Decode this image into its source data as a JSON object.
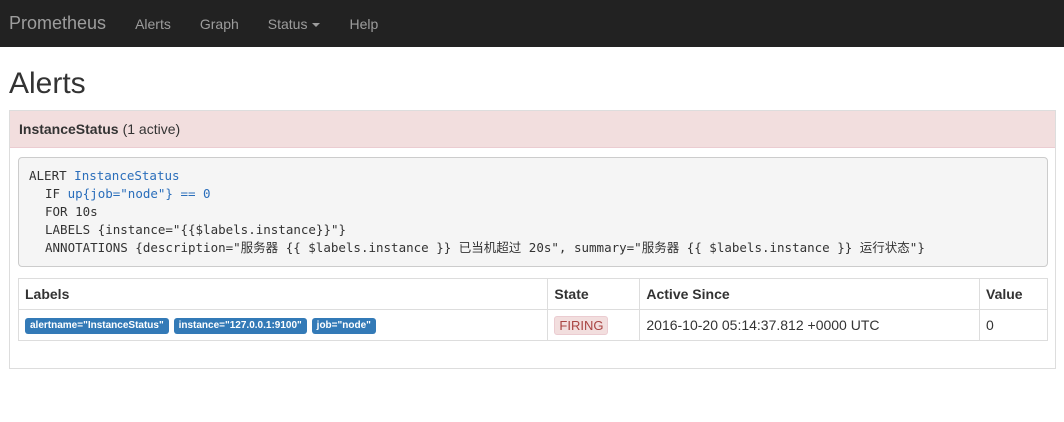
{
  "navbar": {
    "brand": "Prometheus",
    "items": [
      {
        "label": "Alerts"
      },
      {
        "label": "Graph"
      },
      {
        "label": "Status"
      },
      {
        "label": "Help"
      }
    ]
  },
  "page": {
    "title": "Alerts"
  },
  "alert_group": {
    "name": "InstanceStatus",
    "active_count": "(1 active)",
    "rule": {
      "alert_keyword": "ALERT",
      "alert_name": "InstanceStatus",
      "if_keyword": "IF",
      "expr": "up{job=\"node\"} == 0",
      "for_line": "FOR 10s",
      "labels_line": "LABELS {instance=\"{{$labels.instance}}\"}",
      "annotations_line": "ANNOTATIONS {description=\"服务器 {{ $labels.instance }} 已当机超过 20s\", summary=\"服务器 {{ $labels.instance }} 运行状态\"}"
    },
    "table": {
      "headers": {
        "labels": "Labels",
        "state": "State",
        "active_since": "Active Since",
        "value": "Value"
      },
      "rows": [
        {
          "labels": [
            "alertname=\"InstanceStatus\"",
            "instance=\"127.0.0.1:9100\"",
            "job=\"node\""
          ],
          "state": "FIRING",
          "active_since": "2016-10-20 05:14:37.812 +0000 UTC",
          "value": "0"
        }
      ]
    }
  },
  "colors": {
    "navbar_bg": "#222222",
    "nav_text": "#9d9d9d",
    "panel_heading_bg": "#f2dede",
    "label_badge": "#337ab7",
    "firing_text": "#a94442"
  }
}
